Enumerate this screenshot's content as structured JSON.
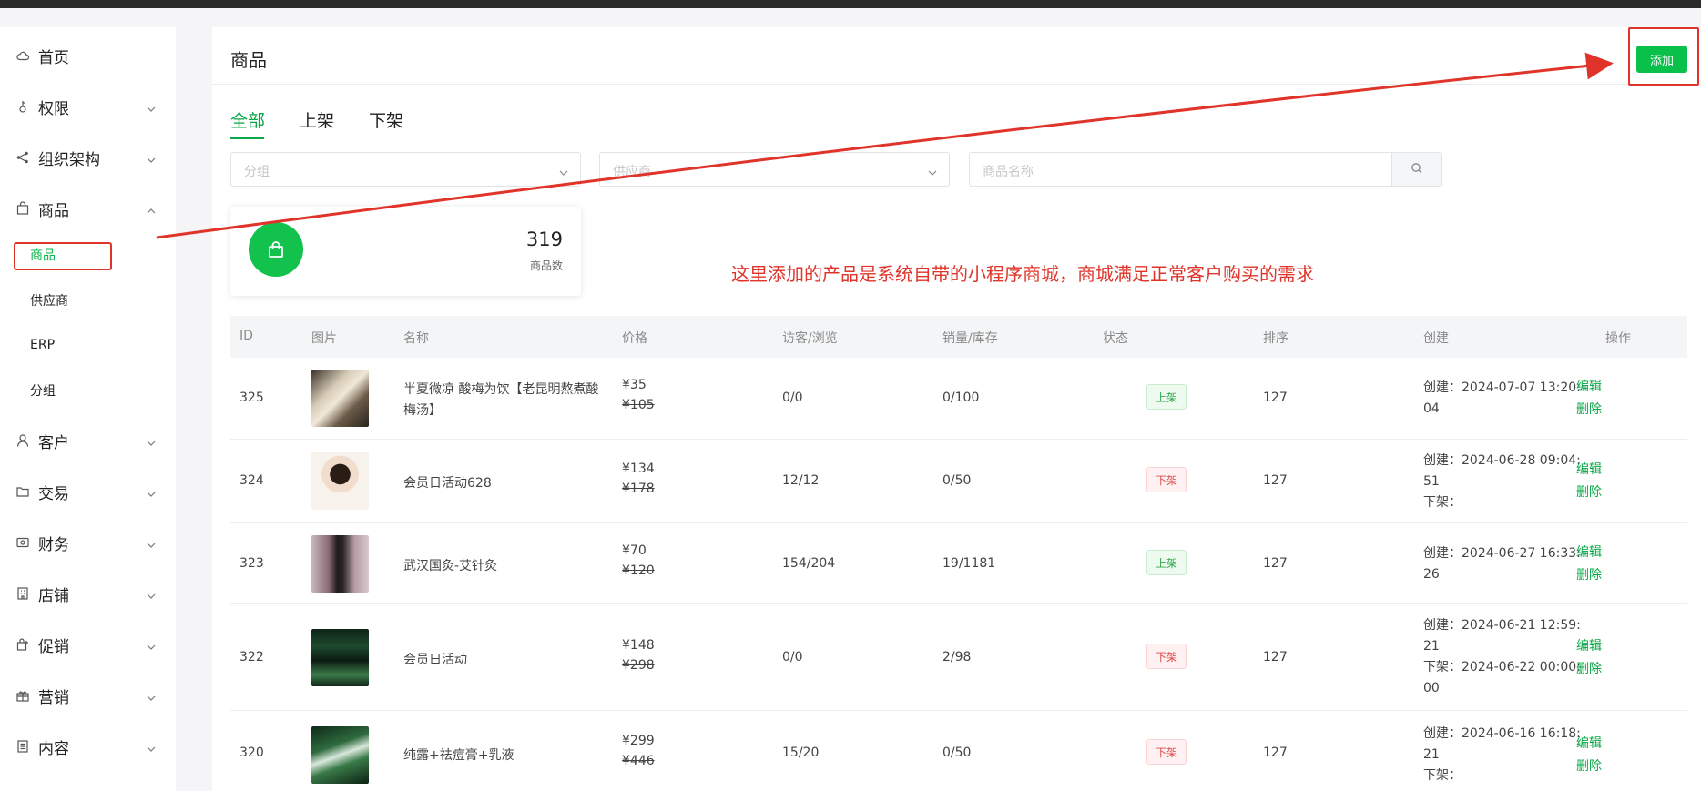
{
  "sidebar": {
    "items": [
      {
        "label": "首页",
        "icon": "cloud-icon",
        "has_chevron": false
      },
      {
        "label": "权限",
        "icon": "key-icon",
        "has_chevron": true
      },
      {
        "label": "组织架构",
        "icon": "share-icon",
        "has_chevron": true
      },
      {
        "label": "商品",
        "icon": "bag-icon",
        "has_chevron": true,
        "expanded": true
      },
      {
        "label": "客户",
        "icon": "user-icon",
        "has_chevron": true
      },
      {
        "label": "交易",
        "icon": "folder-icon",
        "has_chevron": true
      },
      {
        "label": "财务",
        "icon": "wallet-icon",
        "has_chevron": true
      },
      {
        "label": "店铺",
        "icon": "building-icon",
        "has_chevron": true
      },
      {
        "label": "促销",
        "icon": "gift-bag-icon",
        "has_chevron": true
      },
      {
        "label": "营销",
        "icon": "gift-icon",
        "has_chevron": true
      },
      {
        "label": "内容",
        "icon": "document-icon",
        "has_chevron": true
      }
    ],
    "sub_items": [
      {
        "label": "商品",
        "active": true
      },
      {
        "label": "供应商",
        "active": false
      },
      {
        "label": "ERP",
        "active": false
      },
      {
        "label": "分组",
        "active": false
      }
    ]
  },
  "header": {
    "title": "商品",
    "add_button": "添加"
  },
  "tabs": [
    {
      "label": "全部",
      "active": true
    },
    {
      "label": "上架",
      "active": false
    },
    {
      "label": "下架",
      "active": false
    }
  ],
  "filters": {
    "group_placeholder": "分组",
    "supplier_placeholder": "供应商",
    "name_placeholder": "商品名称"
  },
  "stat": {
    "value": "319",
    "label": "商品数"
  },
  "annotation": "这里添加的产品是系统自带的小程序商城，商城满足正常客户购买的需求",
  "table": {
    "columns": [
      "ID",
      "图片",
      "名称",
      "价格",
      "访客/浏览",
      "销量/库存",
      "状态",
      "排序",
      "创建",
      "操作"
    ],
    "rows": [
      {
        "id": "325",
        "name": "半夏微凉 酸梅为饮【老昆明熬煮酸梅汤】",
        "price": "¥35",
        "orig_price": "¥105",
        "visitors": "0/0",
        "sales": "0/100",
        "status": "上架",
        "status_on": true,
        "sort": "127",
        "created": "创建：2024-07-07 13:20:04",
        "offline": "",
        "edit": "编辑",
        "delete": "删除"
      },
      {
        "id": "324",
        "name": "会员日活动628",
        "price": "¥134",
        "orig_price": "¥178",
        "visitors": "12/12",
        "sales": "0/50",
        "status": "下架",
        "status_on": false,
        "sort": "127",
        "created": "创建：2024-06-28 09:04:51",
        "offline": "下架：",
        "edit": "编辑",
        "delete": "删除"
      },
      {
        "id": "323",
        "name": "武汉国灸-艾针灸",
        "price": "¥70",
        "orig_price": "¥120",
        "visitors": "154/204",
        "sales": "19/1181",
        "status": "上架",
        "status_on": true,
        "sort": "127",
        "created": "创建：2024-06-27 16:33:26",
        "offline": "",
        "edit": "编辑",
        "delete": "删除"
      },
      {
        "id": "322",
        "name": "会员日活动",
        "price": "¥148",
        "orig_price": "¥298",
        "visitors": "0/0",
        "sales": "2/98",
        "status": "下架",
        "status_on": false,
        "sort": "127",
        "created": "创建：2024-06-21 12:59:21",
        "offline": "下架：2024-06-22 00:00:00",
        "edit": "编辑",
        "delete": "删除"
      },
      {
        "id": "320",
        "name": "纯露+祛痘膏+乳液",
        "price": "¥299",
        "orig_price": "¥446",
        "visitors": "15/20",
        "sales": "0/50",
        "status": "下架",
        "status_on": false,
        "sort": "127",
        "created": "创建：2024-06-16 16:18:21",
        "offline": "下架：",
        "edit": "编辑",
        "delete": "删除"
      }
    ]
  },
  "colors": {
    "accent": "#09c04b",
    "annotation": "#e0342a"
  }
}
